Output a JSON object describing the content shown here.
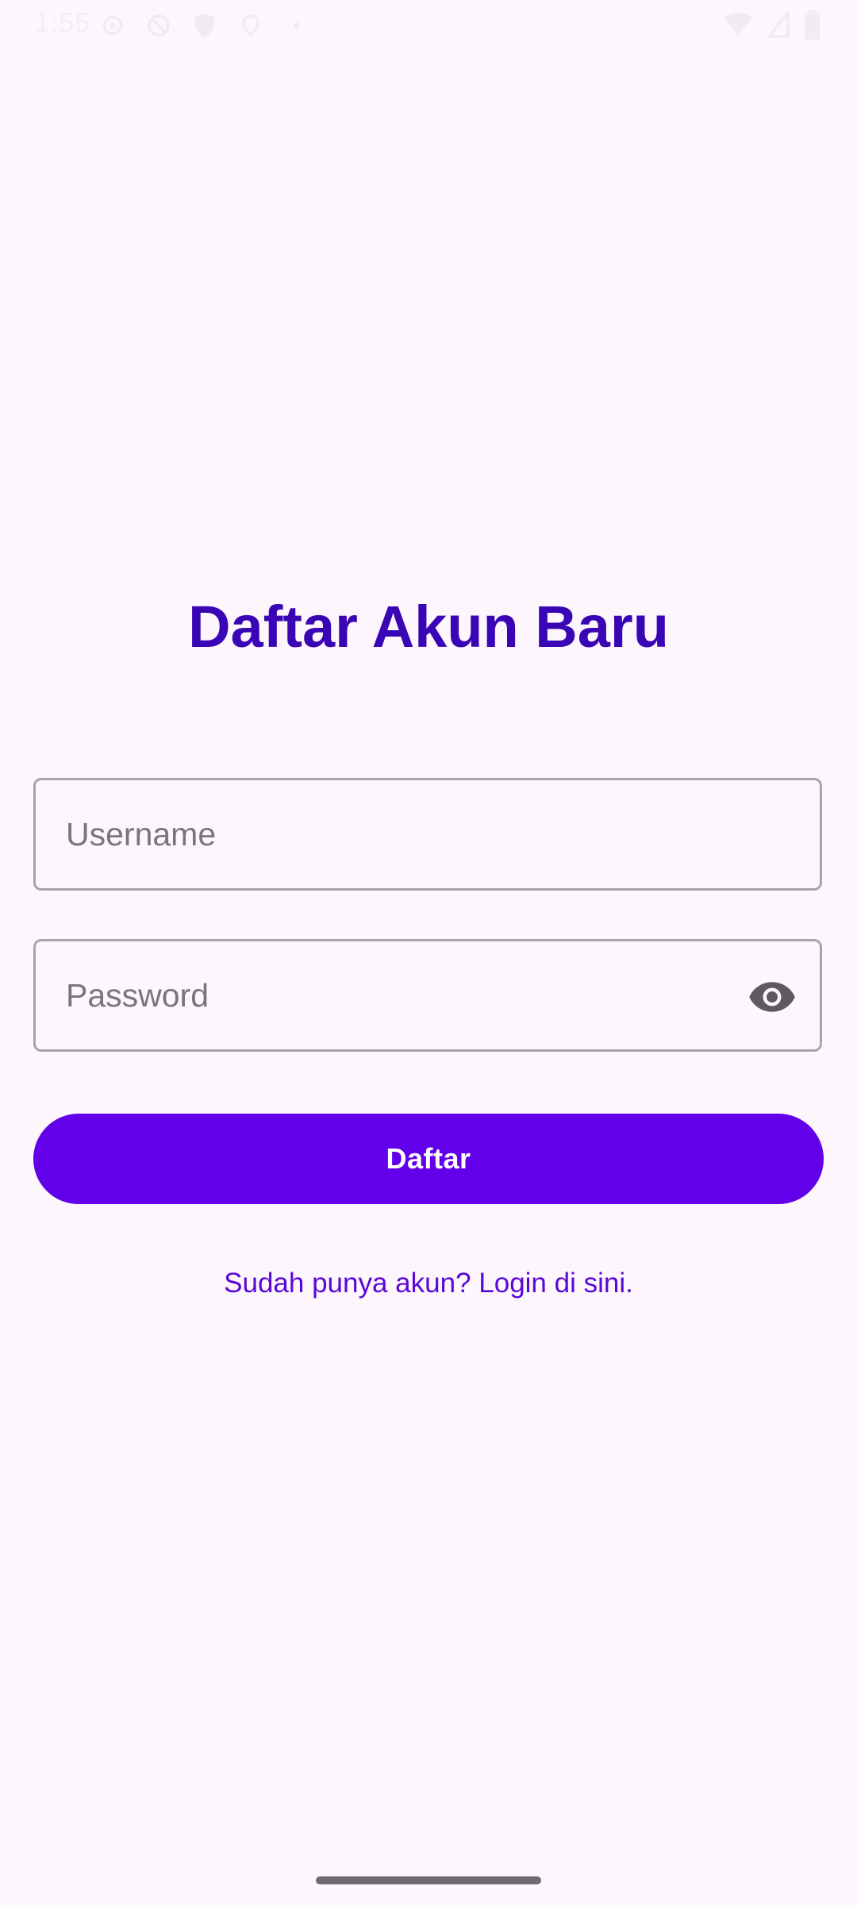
{
  "status_bar": {
    "time": "1:55",
    "left_icons": [
      "settings-icon",
      "do-not-disturb-icon",
      "shield-icon",
      "location-icon",
      "dot-icon"
    ],
    "right_icons": [
      "wifi-icon",
      "signal-icon",
      "battery-icon"
    ]
  },
  "page": {
    "title": "Daftar Akun Baru"
  },
  "form": {
    "username": {
      "value": "",
      "placeholder": "Username"
    },
    "password": {
      "value": "",
      "placeholder": "Password",
      "toggle_icon": "eye-icon"
    },
    "submit_label": "Daftar",
    "login_link": "Sudah punya akun? Login di sini."
  },
  "colors": {
    "background": "#fdf6fc",
    "title": "#3a05b5",
    "primary": "#6200ea",
    "link": "#5a08d6",
    "field_border": "#a8a3ad"
  }
}
